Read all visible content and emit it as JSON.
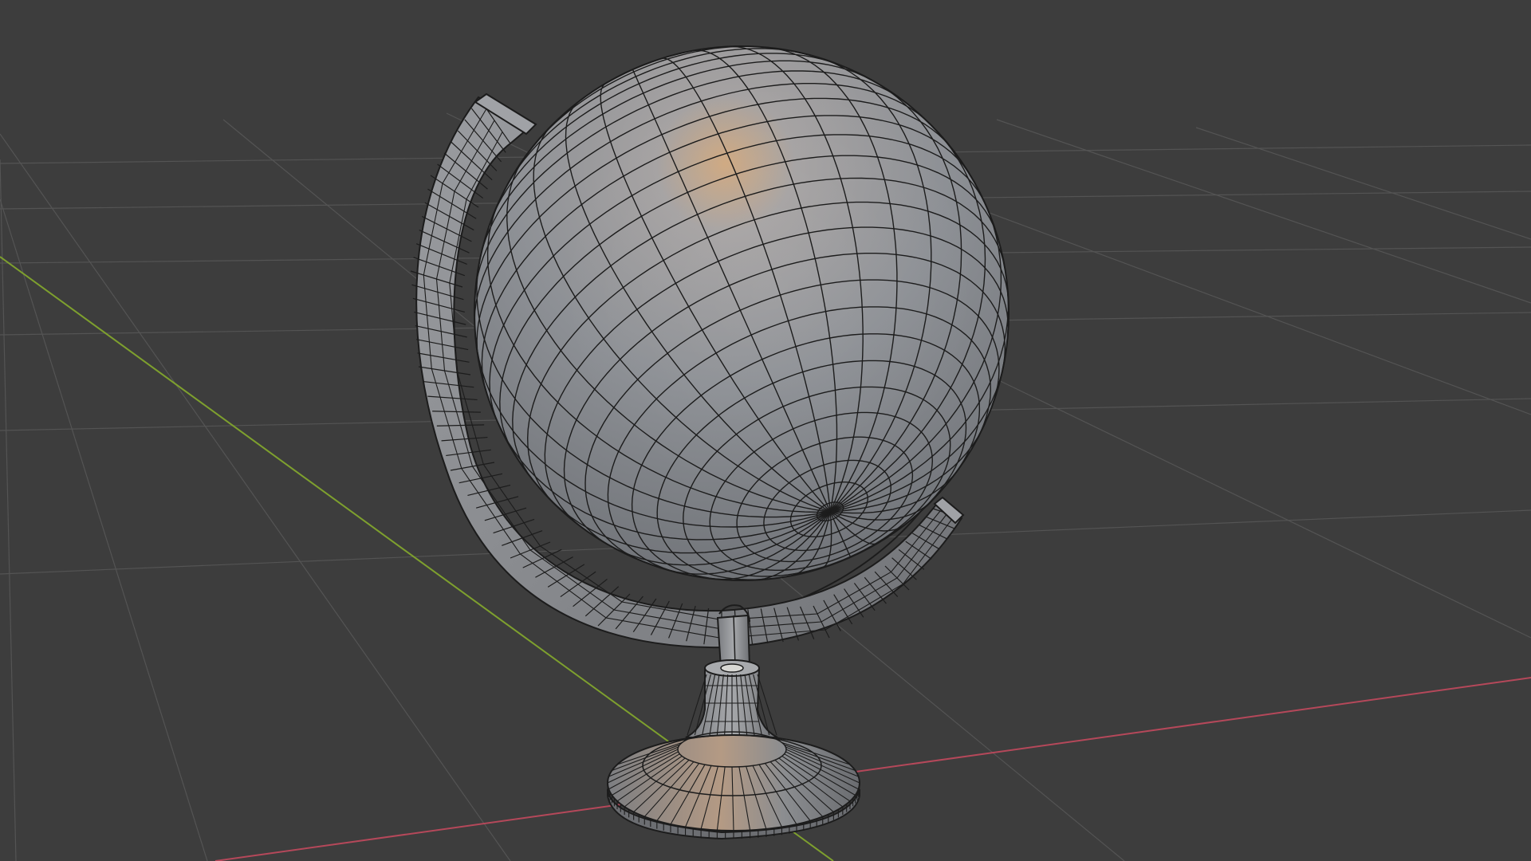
{
  "viewport": {
    "background_color": "#3d3d3d",
    "grid_line_color": "#545454",
    "x_axis_color": "#b5485a",
    "y_axis_color": "#7ea02e"
  },
  "model": {
    "name": "globe",
    "shading": "solid",
    "wireframe_overlay": true,
    "surface_color": "#8e9094",
    "edge_color": "#1c1c1c",
    "highlight_color": "#d9b183",
    "parts": [
      "sphere",
      "meridian-arc",
      "support-stem",
      "pedestal-neck",
      "pedestal-base"
    ]
  }
}
